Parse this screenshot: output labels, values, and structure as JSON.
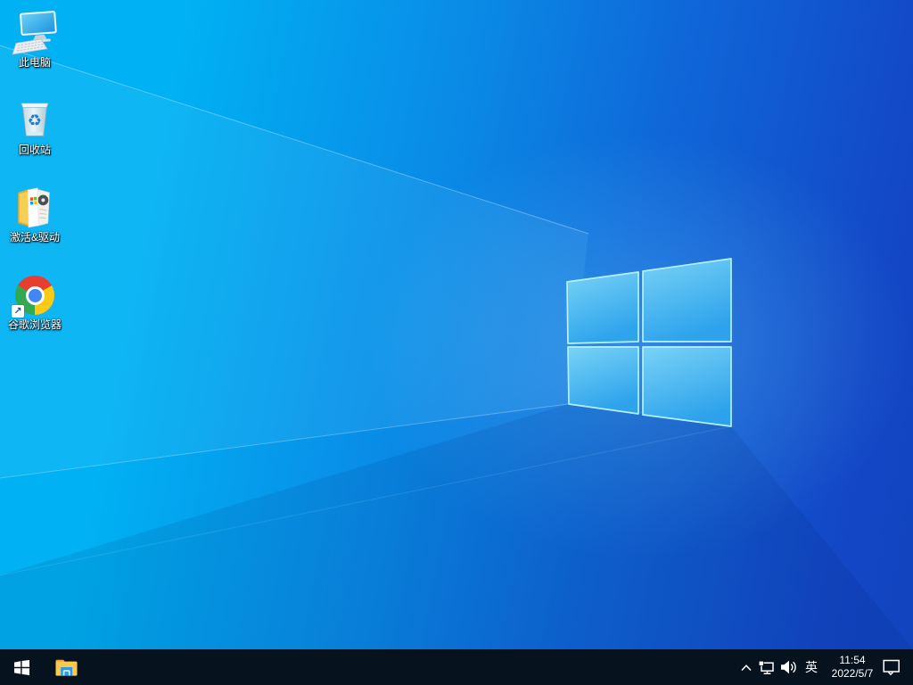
{
  "colors": {
    "wallpaper_left": "#00b1f3",
    "wallpaper_mid": "#0a8ae6",
    "wallpaper_right": "#1347c6",
    "logo_edge": "#b5f1fd",
    "logo_pane_top": "#7fd9f7",
    "logo_pane_bottom": "#2ea6ed",
    "taskbar_bg": "#06131e",
    "taskbar_fg": "#ffffff",
    "chrome_red": "#e83e30",
    "chrome_yellow": "#fcc913",
    "chrome_green": "#33a852",
    "chrome_blue": "#4285f4"
  },
  "wallpaper": {
    "description": "Windows 10 light-ray wallpaper, glowing four-pane window logo right of center",
    "logo_icon": "windows-logo"
  },
  "desktop_icons": [
    {
      "id": "this-pc",
      "label": "此电脑",
      "icon": "this-pc-icon"
    },
    {
      "id": "recycle-bin",
      "label": "回收站",
      "icon": "recycle-bin-icon"
    },
    {
      "id": "activation-drivers",
      "label": "激活&驱动",
      "icon": "open-folder-icon"
    },
    {
      "id": "chrome",
      "label": "谷歌浏览器",
      "icon": "chrome-icon",
      "badge_icon": "shortcut-arrow-icon",
      "badge_glyph": "↗"
    }
  ],
  "taskbar": {
    "start_icon": "windows-start-icon",
    "pinned": [
      {
        "id": "file-explorer",
        "icon": "file-explorer-icon"
      }
    ],
    "tray": {
      "hidden_icons_icon": "chevron-up-icon",
      "network_icon": "ethernet-network-icon",
      "volume_icon": "speaker-volume-icon",
      "ime_label": "英",
      "clock_time": "11:54",
      "clock_date": "2022/5/7",
      "action_center_icon": "action-center-bubble-icon"
    }
  }
}
